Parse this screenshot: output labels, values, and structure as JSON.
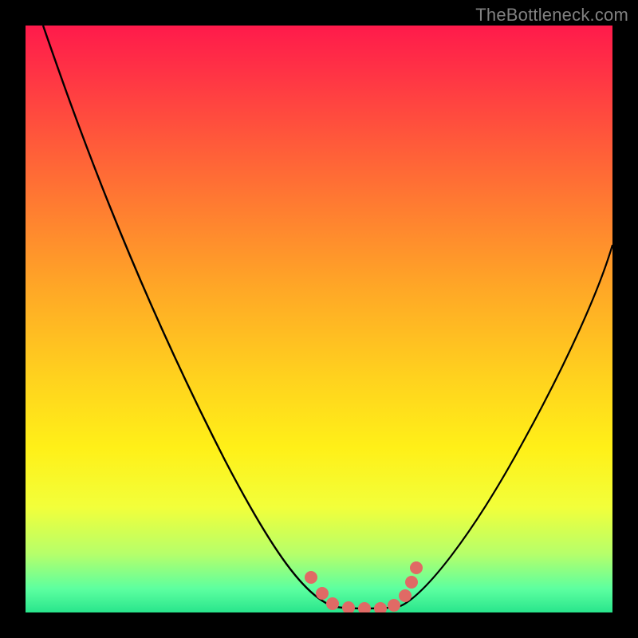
{
  "watermark": "TheBottleneck.com",
  "chart_data": {
    "type": "line",
    "title": "",
    "xlabel": "",
    "ylabel": "",
    "xlim": [
      0,
      100
    ],
    "ylim": [
      0,
      100
    ],
    "grid": false,
    "legend": false,
    "series": [
      {
        "name": "left-descending-curve",
        "x": [
          3,
          10,
          20,
          30,
          40,
          46,
          50,
          52
        ],
        "y": [
          100,
          84,
          63,
          43,
          25,
          12,
          3,
          1
        ]
      },
      {
        "name": "valley-floor",
        "x": [
          52,
          55,
          58,
          61,
          64
        ],
        "y": [
          1,
          0.5,
          0.5,
          0.5,
          1
        ]
      },
      {
        "name": "right-ascending-curve",
        "x": [
          64,
          68,
          75,
          85,
          95,
          100
        ],
        "y": [
          1,
          5,
          16,
          34,
          53,
          63
        ]
      }
    ],
    "markers": {
      "name": "valley-markers",
      "x": [
        48.5,
        50.5,
        52,
        55,
        58,
        61,
        63,
        64.5,
        65.5,
        66
      ],
      "y": [
        6,
        3,
        1.2,
        0.6,
        0.6,
        0.6,
        1.2,
        3,
        5.5,
        8
      ]
    }
  }
}
